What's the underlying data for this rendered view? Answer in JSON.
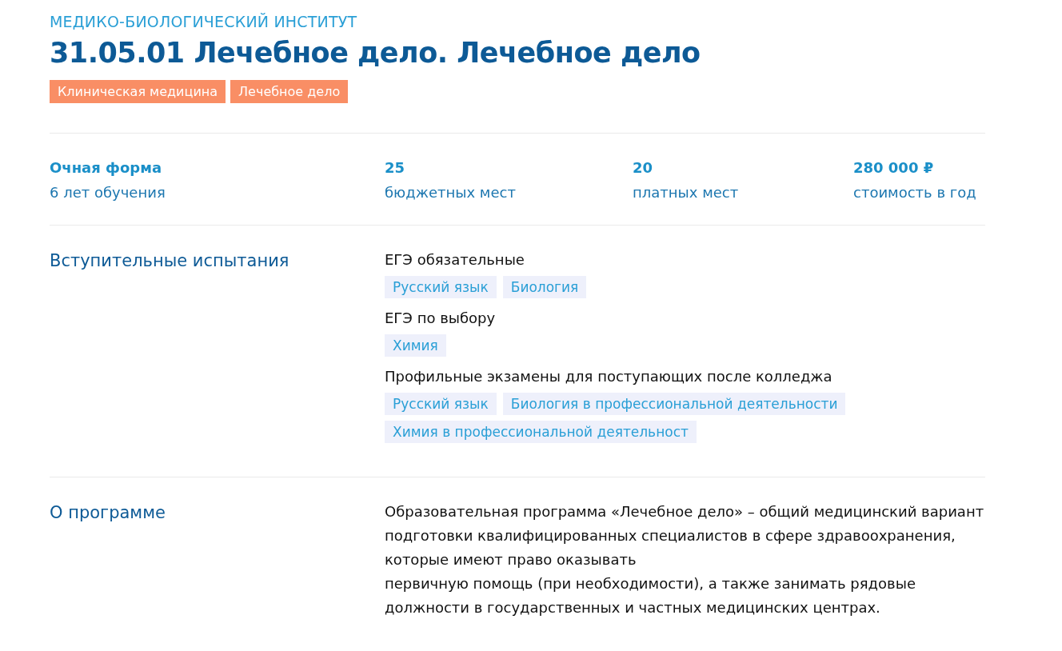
{
  "institute": "МЕДИКО-БИОЛОГИЧЕСКИЙ ИНСТИТУТ",
  "title": "31.05.01 Лечебное дело. Лечебное дело",
  "tags": [
    "Клиническая медицина",
    "Лечебное дело"
  ],
  "stats": [
    {
      "value": "Очная форма",
      "label": "6 лет обучения"
    },
    {
      "value": "25",
      "label": "бюджетных мест"
    },
    {
      "value": "20",
      "label": "платных мест"
    },
    {
      "value": "280 000 ₽",
      "label": "стоимость в год"
    }
  ],
  "exams": {
    "heading": "Вступительные испытания",
    "groups": [
      {
        "title": "ЕГЭ обязательные",
        "subjects": [
          "Русский язык",
          "Биология"
        ]
      },
      {
        "title": "ЕГЭ по выбору",
        "subjects": [
          "Химия"
        ]
      },
      {
        "title": "Профильные экзамены для поступающих после колледжа",
        "subjects": [
          "Русский язык",
          "Биология в профессиональной деятельности",
          "Химия в профессиональной деятельност"
        ]
      }
    ]
  },
  "about": {
    "heading": "О программе",
    "text": "Образовательная программа «Лечебное дело» – общий медицинский вариант подготовки квалифицированных специалистов в сфере здравоохранения, которые имеют право оказывать\nпервичную помощь (при необходимости), а также занимать рядовые должности в государственных и частных медицинских центрах."
  }
}
